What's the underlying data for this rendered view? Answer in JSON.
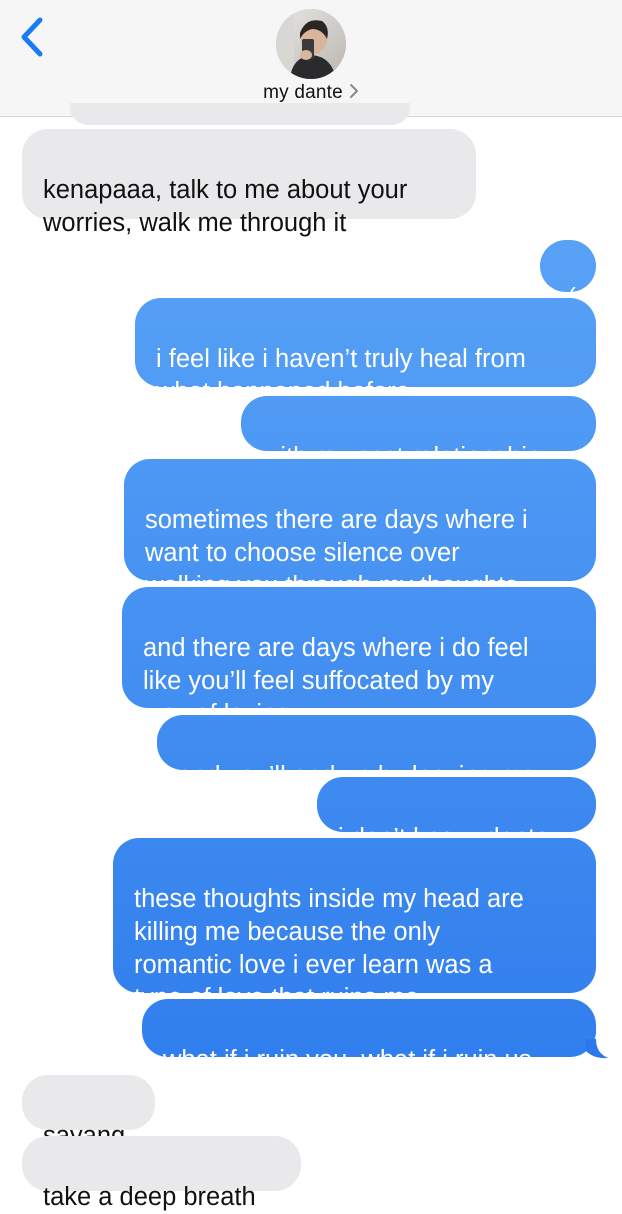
{
  "header": {
    "contact_name": "my dante"
  },
  "messages": [
    {
      "id": "m1",
      "direction": "incoming",
      "text": "kenapaaa, talk to me about your\nworries, walk me through it"
    },
    {
      "id": "m2",
      "direction": "outgoing",
      "text": ":("
    },
    {
      "id": "m3",
      "direction": "outgoing",
      "text": "i feel like i haven’t truly heal from\nwhat happened before"
    },
    {
      "id": "m4",
      "direction": "outgoing",
      "text": "with my past relationship"
    },
    {
      "id": "m5",
      "direction": "outgoing",
      "text": "sometimes there are days where i\nwant to choose silence over\nwalking you through my thoughts"
    },
    {
      "id": "m6",
      "direction": "outgoing",
      "text": "and there are days where i do feel\nlike you’ll feel suffocated by my\nway of loving"
    },
    {
      "id": "m7",
      "direction": "outgoing",
      "text": "and you’ll end up by leaving me"
    },
    {
      "id": "m8",
      "direction": "outgoing",
      "text": "i don’t know, dante"
    },
    {
      "id": "m9",
      "direction": "outgoing",
      "text": "these thoughts inside my head are\nkilling me because the only\nromantic love i ever learn was a\ntype of love that ruins me"
    },
    {
      "id": "m10",
      "direction": "outgoing",
      "text": "what if i ruin you, what if i ruin us"
    },
    {
      "id": "m11",
      "direction": "incoming",
      "text": "sayang"
    },
    {
      "id": "m12",
      "direction": "incoming",
      "text": "take a deep breath"
    }
  ],
  "colors": {
    "incoming_bubble": "#e9e9eb",
    "outgoing_gradient_top": "#63acf8",
    "outgoing_gradient_bottom": "#2a78ec",
    "accent": "#1a7cf5"
  },
  "icons": {
    "back": "chevron-left-icon",
    "contact_disclosure": "chevron-right-icon"
  }
}
